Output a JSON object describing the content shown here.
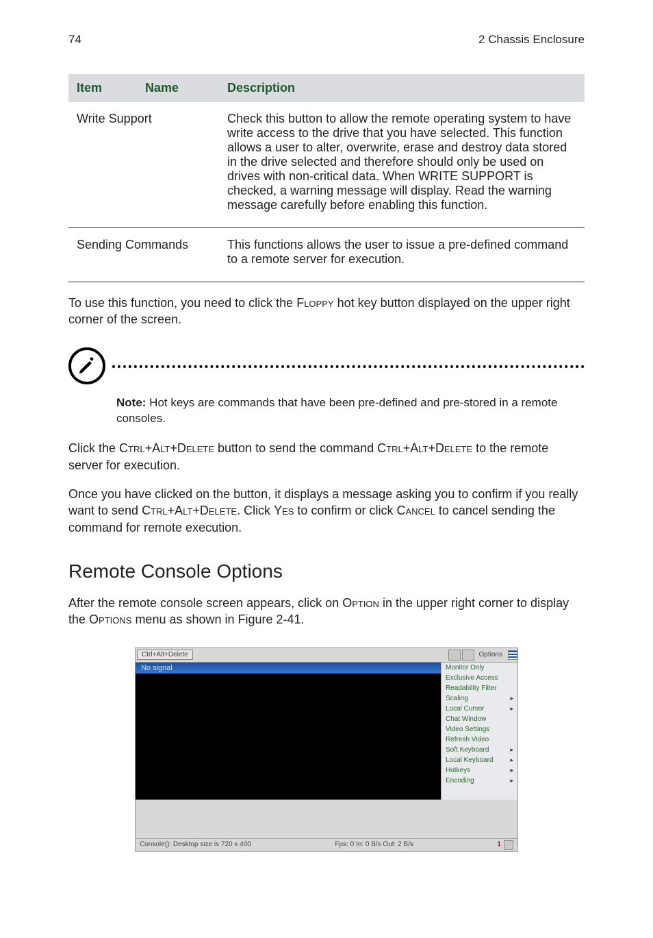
{
  "header": {
    "page_number": "74",
    "chapter": "2 Chassis Enclosure"
  },
  "table": {
    "head": {
      "item": "Item",
      "name": "Name",
      "description": "Description"
    },
    "rows": [
      {
        "name": "Write Support",
        "desc": "Check this button to allow the remote operating system to have write access to the drive that you have selected. This function allows a user to alter, overwrite, erase and destroy data stored in the drive selected and therefore should only be used on drives with non-critical data. When WRITE SUPPORT is checked, a warning message will display. Read the warning message carefully before enabling this function."
      },
      {
        "name": "Sending Commands",
        "desc": "This functions allows the user to issue a pre-defined command to a remote server for execution."
      }
    ]
  },
  "para1a": "To use this function, you need to click the ",
  "para1_sc1": "Floppy",
  "para1b": " hot key button displayed on the upper right corner of the screen.",
  "note_label": "Note:",
  "note_text": " Hot keys are commands that have been pre-defined and pre-stored in a remote consoles.",
  "para2a": "Click the ",
  "para2_sc1": "Ctrl+Alt+Delete",
  "para2b": " button to send the command ",
  "para2_sc2": "Ctrl+Alt+Delete",
  "para2c": " to the remote server for execution.",
  "para3a": "Once you have clicked on the button, it displays a message asking you to confirm if you really want to send ",
  "para3_sc1": "Ctrl+Alt+Delete",
  "para3b": ". Click ",
  "para3_sc2": "Yes",
  "para3c": " to confirm or click ",
  "para3_sc3": "Cancel",
  "para3d": " to cancel sending the command for remote execution.",
  "section_title": "Remote Console Options",
  "para4a": "After the remote console screen appears, click on ",
  "para4_sc1": "Option",
  "para4b": " in the upper right corner to display the ",
  "para4_sc2": "Options",
  "para4c": " menu as shown in Figure 2-41.",
  "screenshot": {
    "top_button": "Ctrl+Alt+Delete",
    "options_label": "Options",
    "title_nosignal": "No signal",
    "menu": [
      {
        "label": "Monitor Only",
        "arrow": false
      },
      {
        "label": "Exclusive Access",
        "arrow": false
      },
      {
        "label": "Readability Filter",
        "arrow": false
      },
      {
        "label": "Scaling",
        "arrow": true
      },
      {
        "label": "Local Cursor",
        "arrow": true
      },
      {
        "label": "Chat Window",
        "arrow": false
      },
      {
        "label": "Video Settings",
        "arrow": false
      },
      {
        "label": "Refresh Video",
        "arrow": false
      },
      {
        "label": "Soft Keyboard",
        "arrow": true
      },
      {
        "label": "Local Keyboard",
        "arrow": true
      },
      {
        "label": "Hotkeys",
        "arrow": true
      },
      {
        "label": "Encoding",
        "arrow": true
      }
    ],
    "status_left": "Console(): Desktop size is 720 x 400",
    "status_mid": "Fps: 0 In: 0 B/s Out: 2 B/s",
    "status_num": "1"
  }
}
